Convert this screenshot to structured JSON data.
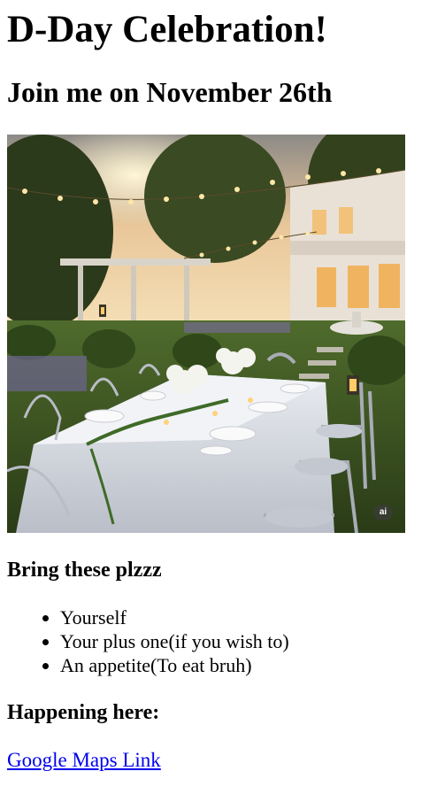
{
  "heading": "D-Day Celebration!",
  "subheading": "Join me on November 26th",
  "image": {
    "alt": "Outdoor garden dinner party with a long table, white flowers and string lights",
    "badge": "ai"
  },
  "bring": {
    "title": "Bring these plzzz",
    "items": [
      "Yourself",
      "Your plus one(if you wish to)",
      "An appetite(To eat bruh)"
    ]
  },
  "location": {
    "title": "Happening here:",
    "link_label": "Google Maps Link"
  }
}
